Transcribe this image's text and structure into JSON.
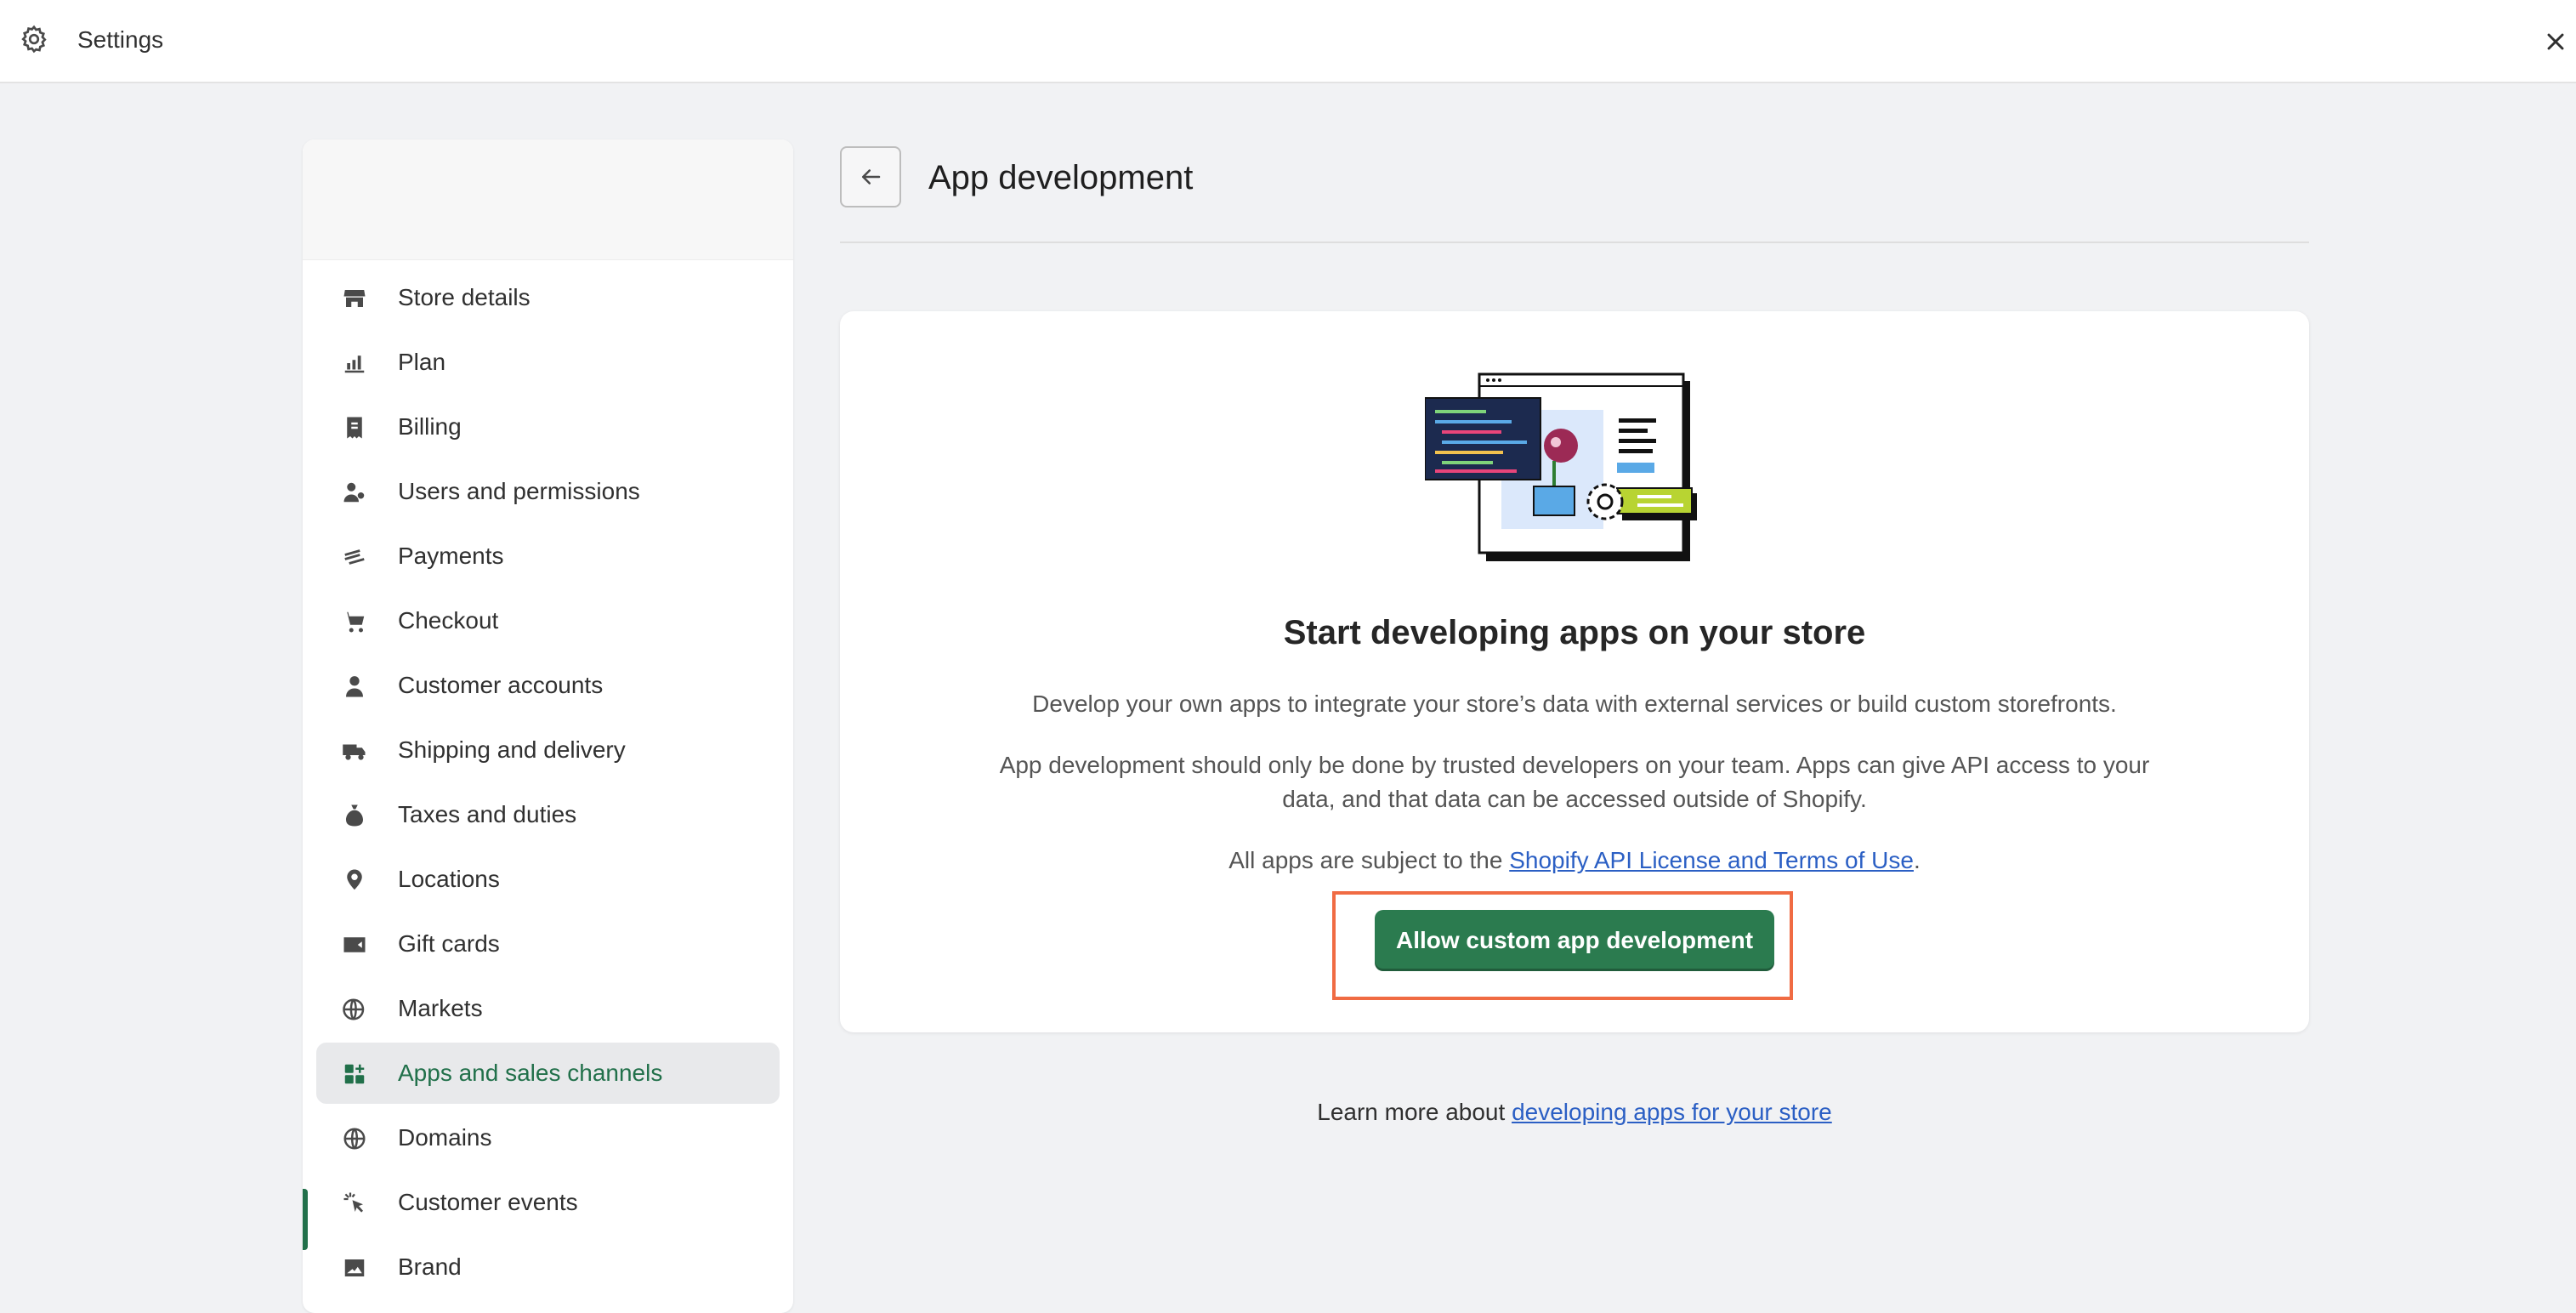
{
  "topbar": {
    "title": "Settings",
    "gear_icon": "gear-icon",
    "close_icon": "close-icon"
  },
  "sidebar": {
    "items": [
      {
        "label": "Store details",
        "icon": "store-icon"
      },
      {
        "label": "Plan",
        "icon": "plan-icon"
      },
      {
        "label": "Billing",
        "icon": "billing-icon"
      },
      {
        "label": "Users and permissions",
        "icon": "users-icon"
      },
      {
        "label": "Payments",
        "icon": "payments-icon"
      },
      {
        "label": "Checkout",
        "icon": "cart-icon"
      },
      {
        "label": "Customer accounts",
        "icon": "person-icon"
      },
      {
        "label": "Shipping and delivery",
        "icon": "truck-icon"
      },
      {
        "label": "Taxes and duties",
        "icon": "money-bag-icon"
      },
      {
        "label": "Locations",
        "icon": "location-pin-icon"
      },
      {
        "label": "Gift cards",
        "icon": "gift-card-icon"
      },
      {
        "label": "Markets",
        "icon": "globe-currency-icon"
      },
      {
        "label": "Apps and sales channels",
        "icon": "apps-icon",
        "active": true
      },
      {
        "label": "Domains",
        "icon": "globe-icon"
      },
      {
        "label": "Customer events",
        "icon": "cursor-click-icon"
      },
      {
        "label": "Brand",
        "icon": "image-icon"
      }
    ],
    "active_color": "#21704a"
  },
  "page": {
    "title": "App development"
  },
  "card": {
    "headline": "Start developing apps on your store",
    "desc1": "Develop your own apps to integrate your store’s data with external services or build custom storefronts.",
    "desc2": "App development should only be done by trusted developers on your team. Apps can give API access to your data, and that data can be accessed outside of Shopify.",
    "terms_prefix": "All apps are subject to the ",
    "terms_link": "Shopify API License and Terms of Use",
    "terms_suffix": ".",
    "button_label": "Allow custom app development",
    "button_color": "#2b7b4f",
    "highlight_color": "#f06b43"
  },
  "footer": {
    "prefix": "Learn more about ",
    "link": "developing apps for your store"
  }
}
